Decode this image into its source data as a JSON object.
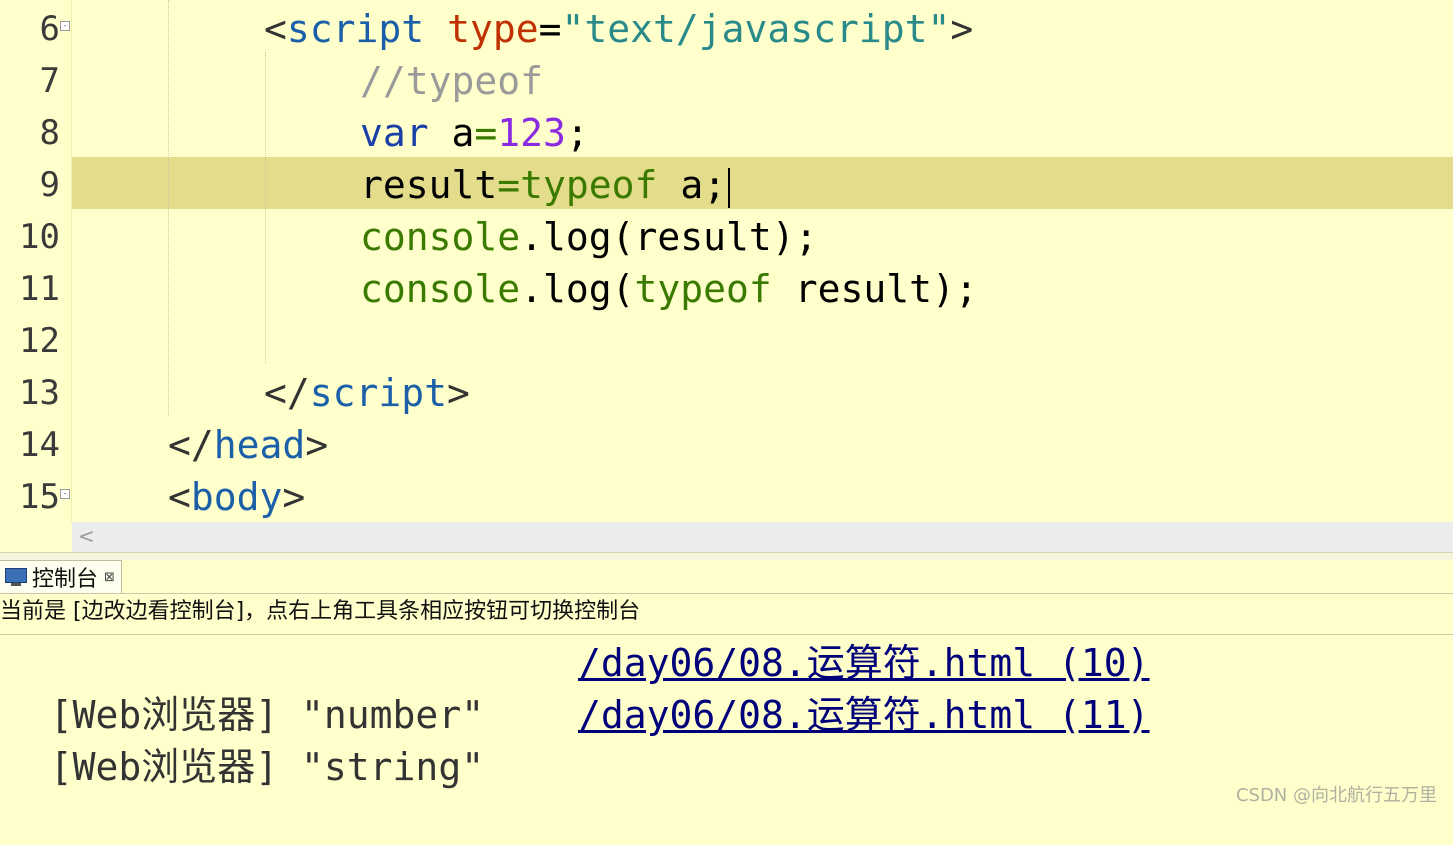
{
  "editor": {
    "line_numbers": [
      "6",
      "7",
      "8",
      "9",
      "10",
      "11",
      "12",
      "13",
      "14",
      "15"
    ],
    "lines": {
      "l6": {
        "open": "<",
        "tag": "script",
        "attr": "type",
        "eq": "=",
        "value": "\"text/javascript\"",
        "close": ">"
      },
      "l7": {
        "comment": "//typeof"
      },
      "l8": {
        "kw": "var",
        "ident": " a",
        "op": "=",
        "num": "123",
        "semi": ";"
      },
      "l9": {
        "ident": "result",
        "op": "=",
        "fn": "typeof",
        "rest": " a;"
      },
      "l10": {
        "fn": "console",
        "rest": ".log(result);"
      },
      "l11": {
        "fn": "console",
        "mid": ".log(",
        "fn2": "typeof",
        "rest": " result);"
      },
      "l13": {
        "open": "</",
        "tag": "script",
        "close": ">"
      },
      "l14": {
        "open": "</",
        "tag": "head",
        "close": ">"
      },
      "l15": {
        "open": "<",
        "tag": "body",
        "close": ">"
      }
    }
  },
  "scrollbar": {
    "left_arrow": "<"
  },
  "console": {
    "tab_label": "控制台",
    "tab_close": "⊠",
    "hint": "当前是 [边改边看控制台]，点右上角工具条相应按钮可切换控制台",
    "rows": [
      {
        "prefix": "[Web浏览器]",
        "value": "\"number\"",
        "source": "/day06/08.运算符.html (10)"
      },
      {
        "prefix": "[Web浏览器]",
        "value": "\"string\"",
        "source": "/day06/08.运算符.html (11)"
      }
    ]
  },
  "watermark": "CSDN @向北航行五万里"
}
